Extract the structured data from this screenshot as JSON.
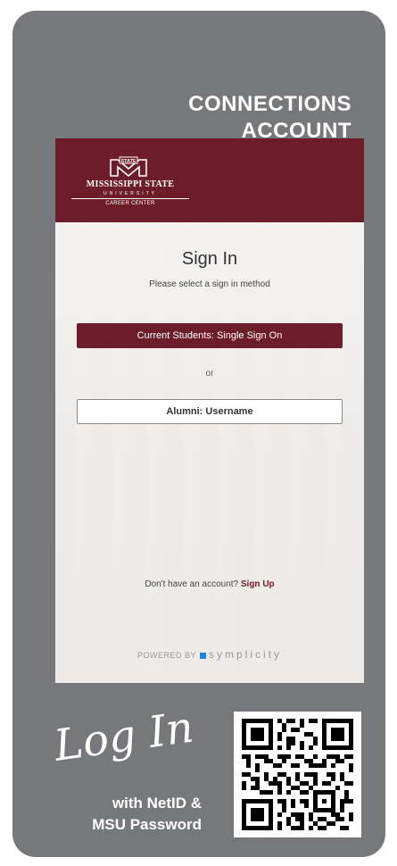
{
  "header": {
    "title_line1": "CONNECTIONS",
    "title_line2": "ACCOUNT"
  },
  "logo": {
    "mark_text": "STATE",
    "name": "MISSISSIPPI STATE",
    "sub": "UNIVERSITY",
    "department": "CAREER CENTER"
  },
  "signin": {
    "title": "Sign In",
    "subtitle": "Please select a sign in method",
    "sso_button": "Current Students: Single Sign On",
    "or_text": "or",
    "alumni_button": "Alumni: Username",
    "signup_prompt": "Don't have an account?",
    "signup_link": "Sign Up",
    "powered_by": "POWERED BY",
    "powered_brand": "symplicity"
  },
  "callout": {
    "login_text": "Log In",
    "instruction_line1": "with NetID &",
    "instruction_line2": "MSU Password"
  },
  "colors": {
    "card": "#76787b",
    "maroon": "#6d1d2a",
    "accent_blue": "#2a7fd4"
  }
}
